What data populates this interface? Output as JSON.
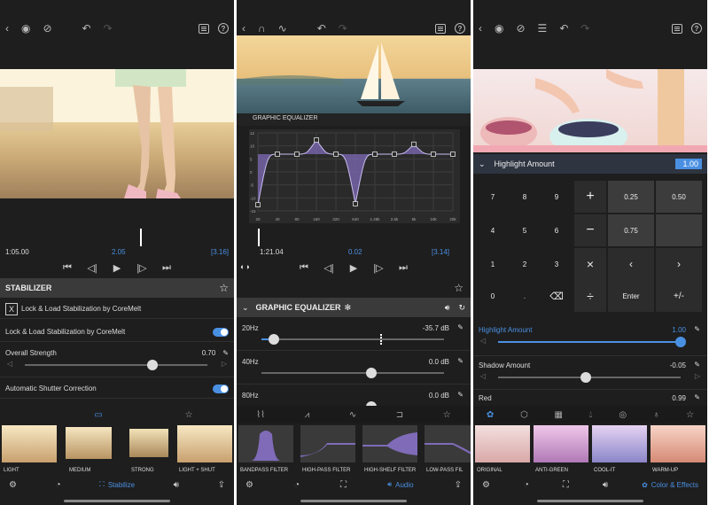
{
  "colors": {
    "accent": "#4a90e2",
    "bg": "#1e1e1e",
    "panel": "#3a3a3a"
  },
  "phone1": {
    "timecodes": {
      "current": "1:05.00",
      "center": "2.05",
      "duration": "[3.16]"
    },
    "section_title": "STABILIZER",
    "effect_name": "Lock & Load Stabilization by CoreMelt",
    "toggle_label": "Lock & Load Stabilization by CoreMelt",
    "strength_label": "Overall Strength",
    "strength_value": "0.70",
    "strength_level": 0.7,
    "shutter_label": "Automatic Shutter Correction",
    "thumbs": [
      "LIGHT",
      "MEDIUM",
      "STRONG",
      "LIGHT + SHUT"
    ],
    "nav_active": "Stabilize"
  },
  "phone2": {
    "eq_title": "GRAPHIC EQUALIZER",
    "eq_y_labels": [
      "12",
      "10",
      "5",
      "0",
      "-5",
      "-10",
      "-15"
    ],
    "eq_x_labels": [
      "20",
      "40",
      "80",
      "160",
      "320",
      "640",
      "1.28k",
      "2.5k",
      "5k",
      "10k",
      "20k"
    ],
    "eq_points_db": [
      -35.7,
      0,
      0,
      10,
      0,
      -35,
      0,
      0,
      7,
      0,
      0
    ],
    "timecodes": {
      "current": "1:21.04",
      "center": "0.02",
      "duration": "[3.14]"
    },
    "section_title": "GRAPHIC EQUALIZER",
    "bands": [
      {
        "freq": "20Hz",
        "value": "-35.7 dB",
        "level": 0.07
      },
      {
        "freq": "40Hz",
        "value": "0.0 dB",
        "level": 0.6
      },
      {
        "freq": "80Hz",
        "value": "0.0 dB",
        "level": 0.6
      }
    ],
    "thumbs": [
      "BANDPASS FILTER",
      "HIGH-PASS FILTER",
      "HIGH-SHELF FILTER",
      "LOW-PASS FIL"
    ],
    "nav_active": "Audio"
  },
  "phone3": {
    "param_title": "Highlight Amount",
    "param_value": "1.00",
    "keys": {
      "digits": [
        "7",
        "8",
        "9",
        "4",
        "5",
        "6",
        "1",
        "2",
        "3",
        "0",
        "."
      ],
      "preset_a": "0.25",
      "preset_b": "0.50",
      "preset_c": "0.75",
      "enter": "Enter",
      "plus_minus": "+/-"
    },
    "highlight_label": "Highlight Amount",
    "highlight_value": "1.00",
    "highlight_level": 1.0,
    "shadow_label": "Shadow Amount",
    "shadow_value": "-0.05",
    "shadow_level": 0.48,
    "red_label": "Red",
    "red_value": "0.99",
    "thumbs": [
      "ORIGINAL",
      "ANTI-GREEN",
      "COOL-IT",
      "WARM-UP"
    ],
    "nav_active": "Color & Effects"
  }
}
